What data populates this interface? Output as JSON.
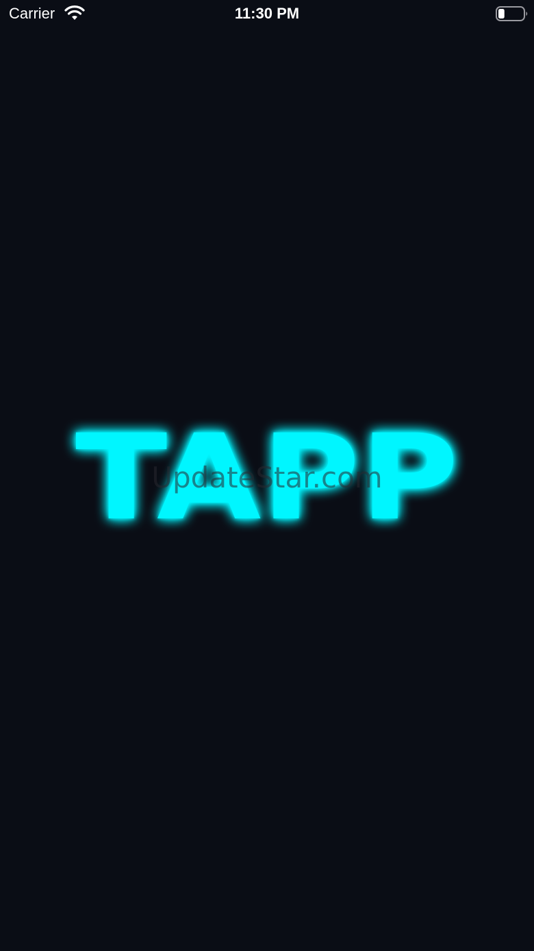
{
  "status_bar": {
    "carrier": "Carrier",
    "time": "11:30 PM",
    "battery_level": 0.25
  },
  "splash": {
    "logo_text": "TAPP",
    "logo_color": "#00f6ff",
    "background_color": "#0a0d15"
  },
  "watermark": {
    "text": "UpdateStar.com"
  }
}
